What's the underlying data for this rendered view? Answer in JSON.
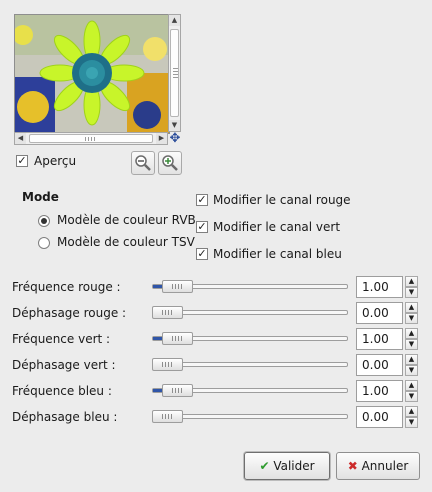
{
  "preview": {
    "checkbox_label": "Aperçu",
    "checked": true
  },
  "mode": {
    "title": "Mode",
    "options": [
      {
        "label": "Modèle de couleur RVB",
        "selected": true
      },
      {
        "label": "Modèle de couleur TSV",
        "selected": false
      }
    ]
  },
  "channels": [
    {
      "label": "Modifier le canal rouge",
      "checked": true
    },
    {
      "label": "Modifier le canal vert",
      "checked": true
    },
    {
      "label": "Modifier le canal bleu",
      "checked": true
    }
  ],
  "sliders": [
    {
      "label": "Fréquence rouge :",
      "value": "1.00",
      "level": 0.0625
    },
    {
      "label": "Déphasage rouge :",
      "value": "0.00",
      "level": 0.0
    },
    {
      "label": "Fréquence vert :",
      "value": "1.00",
      "level": 0.0625
    },
    {
      "label": "Déphasage vert :",
      "value": "0.00",
      "level": 0.0
    },
    {
      "label": "Fréquence bleu :",
      "value": "1.00",
      "level": 0.0625
    },
    {
      "label": "Déphasage bleu :",
      "value": "0.00",
      "level": 0.0
    }
  ],
  "buttons": {
    "ok": "Valider",
    "cancel": "Annuler"
  },
  "colors": {
    "accent": "#2f55a8",
    "ok_icon": "#2e9b2e",
    "cancel_icon": "#cc2a2a"
  },
  "icons": [
    "navigate-icon",
    "zoom-out-icon",
    "zoom-in-icon",
    "check-icon",
    "cancel-x-icon"
  ]
}
